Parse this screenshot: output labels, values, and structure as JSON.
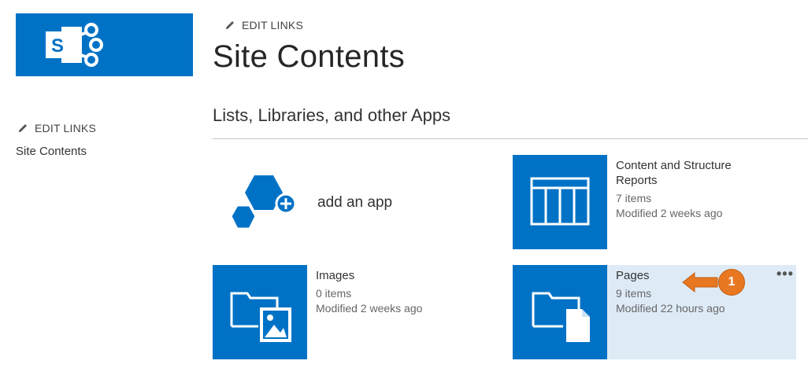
{
  "logo": {
    "icon": "sharepoint-logo-icon",
    "letter": "S",
    "color": "#0072c6"
  },
  "top_edit_links": {
    "icon": "pencil-icon",
    "label": "EDIT LINKS"
  },
  "page_title": "Site Contents",
  "sidebar": {
    "edit_links": {
      "icon": "pencil-icon",
      "label": "EDIT LINKS"
    },
    "items": [
      {
        "label": "Site Contents"
      }
    ]
  },
  "section_title": "Lists, Libraries, and other Apps",
  "add_app": {
    "icon": "add-app-icon",
    "label": "add an app"
  },
  "tiles": [
    {
      "name": "Content and Structure Reports",
      "title_line1": "Content and Structure",
      "title_line2": "Reports",
      "icon": "list-table-icon",
      "count": "7 items",
      "modified": "Modified 2 weeks ago"
    },
    {
      "name": "Images",
      "title": "Images",
      "icon": "image-library-icon",
      "count": "0 items",
      "modified": "Modified 2 weeks ago"
    },
    {
      "name": "Pages",
      "title": "Pages",
      "icon": "pages-library-icon",
      "count": "9 items",
      "modified": "Modified 22 hours ago",
      "menu_label": "•••",
      "hovered": true
    }
  ],
  "annotation": {
    "number": "1",
    "icon": "arrow-left-icon",
    "color": "#e87722"
  },
  "colors": {
    "brand": "#0072c6",
    "hover": "#deebf7",
    "callout": "#e87722"
  }
}
